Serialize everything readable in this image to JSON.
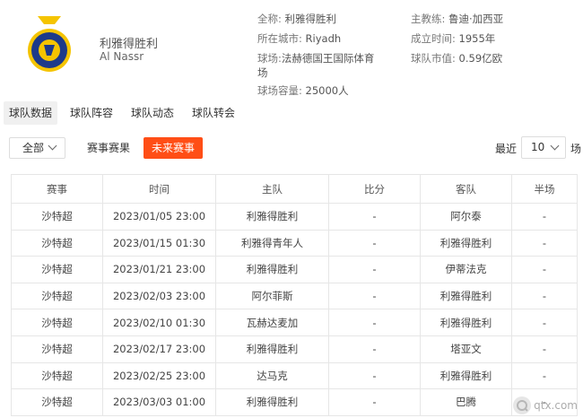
{
  "team": {
    "name_cn": "利雅得胜利",
    "name_en": "Al Nassr"
  },
  "info": {
    "full_name_label": "全称:",
    "full_name": "利雅得胜利",
    "city_label": "所在城市:",
    "city": "Riyadh",
    "stadium_label": "球场:",
    "stadium_line1": "法赫德国王国际体育",
    "stadium_line2": "场",
    "capacity_label": "球场容量:",
    "capacity": "25000人",
    "coach_label": "主教练:",
    "coach": "鲁迪·加西亚",
    "founded_label": "成立时间:",
    "founded": "1955年",
    "value_label": "球队市值:",
    "value": "0.59亿欧"
  },
  "tabs": [
    {
      "label": "球队数据",
      "active": true
    },
    {
      "label": "球队阵容",
      "active": false
    },
    {
      "label": "球队动态",
      "active": false
    },
    {
      "label": "球队转会",
      "active": false
    }
  ],
  "filters": {
    "competition_select": "全部",
    "results_label": "赛事赛果",
    "future_label": "未来赛事",
    "recent_label": "最近",
    "recent_value": "10",
    "unit_label": "场"
  },
  "colors": {
    "accent": "#ff4e16",
    "logo_blue": "#1d3a8a",
    "logo_yellow": "#f5c400"
  },
  "table": {
    "headers": [
      "赛事",
      "时间",
      "主队",
      "比分",
      "客队",
      "半场"
    ],
    "rows": [
      [
        "沙特超",
        "2023/01/05 23:00",
        "利雅得胜利",
        "-",
        "阿尔泰",
        "-"
      ],
      [
        "沙特超",
        "2023/01/15 01:30",
        "利雅得青年人",
        "-",
        "利雅得胜利",
        "-"
      ],
      [
        "沙特超",
        "2023/01/21 23:00",
        "利雅得胜利",
        "-",
        "伊蒂法克",
        "-"
      ],
      [
        "沙特超",
        "2023/02/03 23:00",
        "阿尔菲斯",
        "-",
        "利雅得胜利",
        "-"
      ],
      [
        "沙特超",
        "2023/02/10 01:30",
        "瓦赫达麦加",
        "-",
        "利雅得胜利",
        "-"
      ],
      [
        "沙特超",
        "2023/02/17 23:00",
        "利雅得胜利",
        "-",
        "塔亚文",
        "-"
      ],
      [
        "沙特超",
        "2023/02/25 23:00",
        "达马克",
        "-",
        "利雅得胜利",
        "-"
      ],
      [
        "沙特超",
        "2023/03/03 01:00",
        "利雅得胜利",
        "-",
        "巴腾",
        "-"
      ]
    ]
  },
  "watermark": {
    "icon": "qtx-logo-icon",
    "text": "qtx.com"
  }
}
